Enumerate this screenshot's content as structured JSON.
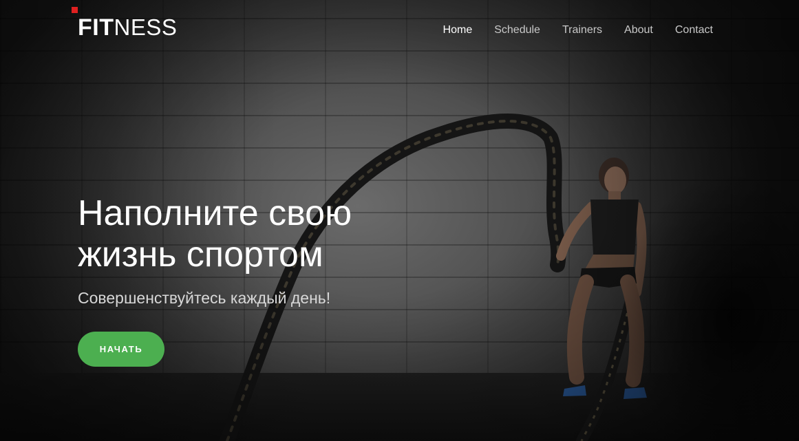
{
  "header": {
    "logo": {
      "bold": "FIT",
      "light": "NESS",
      "mark_color": "#e02020"
    },
    "nav": [
      {
        "label": "Home",
        "active": true
      },
      {
        "label": "Schedule",
        "active": false
      },
      {
        "label": "Trainers",
        "active": false
      },
      {
        "label": "About",
        "active": false
      },
      {
        "label": "Contact",
        "active": false
      }
    ]
  },
  "hero": {
    "title_line1": "Наполните свою",
    "title_line2": "жизнь спортом",
    "subtitle": "Совершенствуйтесь каждый день!",
    "cta_label": "НАЧАТЬ",
    "cta_color": "#4caf50",
    "background_image": "woman-battle-ropes-brick-wall"
  }
}
